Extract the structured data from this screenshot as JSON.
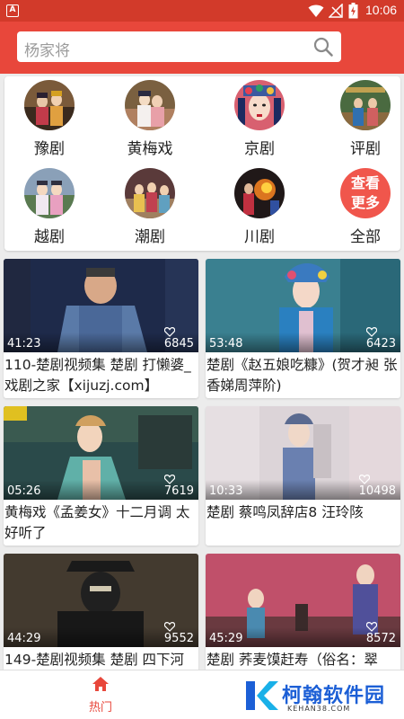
{
  "status_bar": {
    "app_badge": "A",
    "time": "10:06"
  },
  "search": {
    "placeholder": "杨家将"
  },
  "categories": [
    {
      "label": "豫剧",
      "icon": "opera-thumb-yuju"
    },
    {
      "label": "黄梅戏",
      "icon": "opera-thumb-huangmeixi"
    },
    {
      "label": "京剧",
      "icon": "opera-thumb-jingju"
    },
    {
      "label": "评剧",
      "icon": "opera-thumb-pingju"
    },
    {
      "label": "越剧",
      "icon": "opera-thumb-yueju"
    },
    {
      "label": "潮剧",
      "icon": "opera-thumb-chaoju"
    },
    {
      "label": "川剧",
      "icon": "opera-thumb-chuanju"
    },
    {
      "label": "全部",
      "icon": "more-circle",
      "button_text_1": "查看",
      "button_text_2": "更多"
    }
  ],
  "videos": [
    {
      "duration": "41:23",
      "likes": "6845",
      "title": "110-楚剧视频集 楚剧 打懒婆_戏剧之家【xijuzj.com】"
    },
    {
      "duration": "53:48",
      "likes": "6423",
      "title": "楚剧《赵五娘吃糠》(贺才昶 张香娣周萍阶)"
    },
    {
      "duration": "05:26",
      "likes": "7619",
      "title": "黄梅戏《孟姜女》十二月调 太好听了"
    },
    {
      "duration": "10:33",
      "likes": "10498",
      "title": "楚剧 蔡鸣凤辞店8 汪玲陔"
    },
    {
      "duration": "44:29",
      "likes": "9552",
      "title": "149-楚剧视频集 楚剧 四下河"
    },
    {
      "duration": "45:29",
      "likes": "8572",
      "title": "楚剧 荞麦馍赶寿（俗名：翠"
    }
  ],
  "bottom_nav": {
    "home_label": "热门",
    "home_icon": "home-icon"
  },
  "watermark": {
    "brand": "柯翰软件园",
    "url": "KEHAN38.COM"
  },
  "colors": {
    "primary": "#e8473b",
    "status_bar": "#d23a2a",
    "more_button": "#f0564c"
  }
}
